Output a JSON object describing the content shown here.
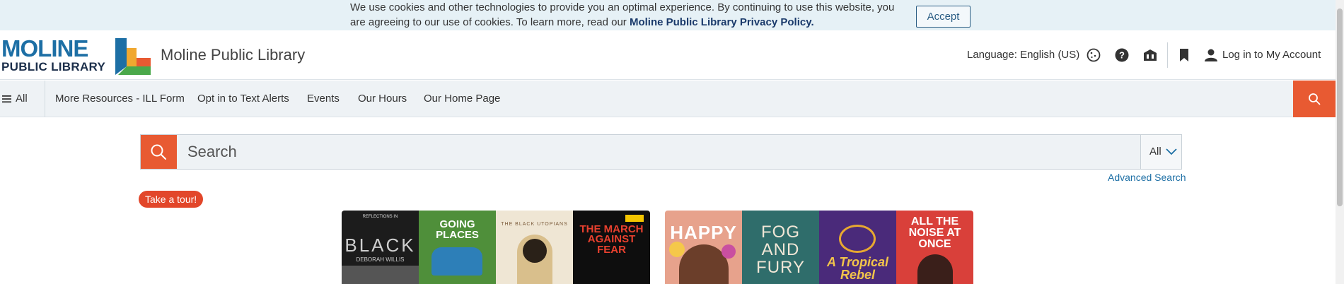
{
  "cookie": {
    "text": "We use cookies and other technologies to provide you an optimal experience. By continuing to use this website, you are agreeing to our use of cookies. To learn more, read our",
    "policy_link": "Moline Public Library Privacy Policy.",
    "accept_label": "Accept"
  },
  "header": {
    "logo_line1": "MOLINE",
    "logo_line2": "PUBLIC LIBRARY",
    "site_title": "Moline Public Library",
    "language_label": "Language: English (US)",
    "login_label": "Log in to My Account",
    "icons": [
      "cookie-icon",
      "help-icon",
      "library-icon",
      "bookmark-icon",
      "user-icon"
    ]
  },
  "nav": {
    "all_label": "All",
    "items": [
      "More Resources - ILL Form",
      "Opt in to Text Alerts",
      "Events",
      "Our Hours",
      "Our Home Page"
    ]
  },
  "search": {
    "placeholder": "Search",
    "scope": "All",
    "advanced_label": "Advanced Search"
  },
  "tour_label": "Take a tour!",
  "carousel1": [
    {
      "title": "BLACK",
      "top": "REFLECTIONS IN",
      "bottom": "DEBORAH WILLIS"
    },
    {
      "title": "GOING PLACES",
      "top": "",
      "bottom": ""
    },
    {
      "title": "THE BLACK UTOPIANS",
      "top": "",
      "bottom": ""
    },
    {
      "title": "THE MARCH AGAINST FEAR",
      "top": "",
      "bottom": ""
    }
  ],
  "carousel2": [
    {
      "title": "HAPPY",
      "top": "",
      "bottom": ""
    },
    {
      "title": "FOG AND FURY",
      "top": "",
      "bottom": ""
    },
    {
      "title": "A Tropical Rebel",
      "top": "",
      "bottom": ""
    },
    {
      "title": "ALL THE NOISE AT ONCE",
      "top": "",
      "bottom": ""
    }
  ],
  "colors": {
    "accent": "#e85a32",
    "brand_blue": "#1d6fa5",
    "banner_bg": "#e6f1f6"
  }
}
